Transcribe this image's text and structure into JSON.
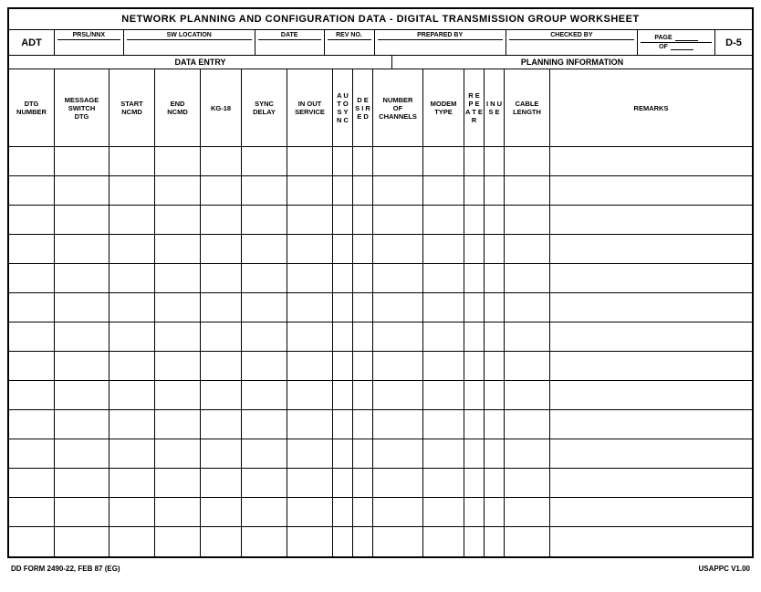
{
  "title": "NETWORK PLANNING AND CONFIGURATION DATA - DIGITAL TRANSMISSION GROUP WORKSHEET",
  "header": {
    "adt_label": "ADT",
    "prsl_label": "PRSL/NNX",
    "sw_location_label": "SW LOCATION",
    "date_label": "DATE",
    "rev_no_label": "REV NO.",
    "prepared_by_label": "PREPARED BY",
    "checked_by_label": "CHECKED BY",
    "page_label": "PAGE",
    "of_label": "OF",
    "page_id": "D-5"
  },
  "sections": {
    "data_entry": "DATA ENTRY",
    "planning_information": "PLANNING INFORMATION"
  },
  "columns": {
    "dtg_number": "DTG NUMBER",
    "message_switch_dtg": "MESSAGE SWITCH DTG",
    "start_ncmd": "START NCMD",
    "end_ncmd": "END NCMD",
    "kg18": "KG-18",
    "sync_delay": "SYNC DELAY",
    "in_out_service": "IN OUT SERVICE",
    "auto_sync": "A U T O S Y N C",
    "desired": "D E S I R E D",
    "number_of_channels": "NUMBER OF CHANNELS",
    "modem_type": "MODEM TYPE",
    "repeater": "R E P E A T E R",
    "in_use": "I N U S E",
    "cable_length": "CABLE LENGTH",
    "remarks": "REMARKS"
  },
  "rows": 14,
  "footer": {
    "form_number": "DD FORM 2490-22, FEB 87 (EG)",
    "version": "USAPPC V1.00"
  }
}
